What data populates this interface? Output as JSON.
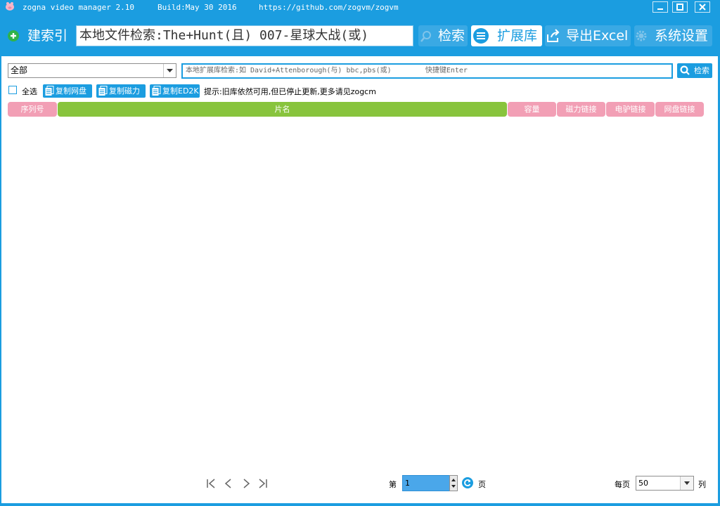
{
  "titlebar": {
    "app": "zogna video manager 2.10",
    "build": "Build:May 30 2016",
    "url": "https://github.com/zogvm/zogvm",
    "buttons": [
      "minimize",
      "maximize",
      "close"
    ]
  },
  "toolbar": {
    "build_index_label": "建索引",
    "search_value": "本地文件检索:The+Hunt(且) 007-星球大战(或)",
    "search_label": "检索",
    "extlib_label": "扩展库",
    "export_label": "导出Excel",
    "settings_label": "系统设置"
  },
  "filter": {
    "category_value": "全部",
    "ext_search_placeholder": "本地扩展库检索:如 David+Attenborough(与) bbc,pbs(或)        快捷键Enter",
    "search_button": "检索"
  },
  "actions": {
    "select_all": "全选",
    "copy_netdisk": "复制网盘",
    "copy_magnet": "复制磁力",
    "copy_ed2k": "复制ED2K",
    "hint": "提示:旧库依然可用,但已停止更新,更多请见zogcm"
  },
  "table": {
    "columns": [
      "序列号",
      "片名",
      "容量",
      "磁力链接",
      "电驴链接",
      "网盘链接"
    ]
  },
  "pager": {
    "page_prefix": "第",
    "page_value": "1",
    "page_suffix": "页",
    "per_page_label": "每页",
    "per_page_value": "50",
    "per_page_suffix": "列"
  },
  "colors": {
    "brand": "#1b9de0",
    "header_pink": "#f29fb5",
    "header_green": "#88c43d"
  }
}
